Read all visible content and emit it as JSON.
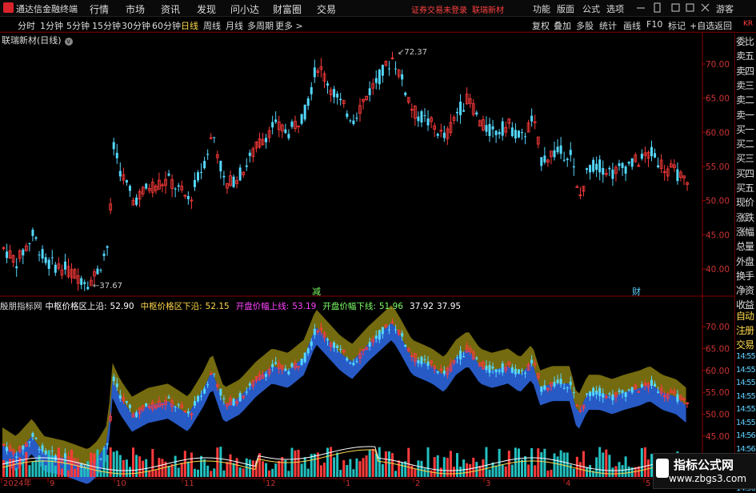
{
  "app": {
    "title": "通达信金融终端",
    "menus": [
      "行情",
      "市场",
      "资讯",
      "发现",
      "问小达",
      "财富圈",
      "交易"
    ],
    "warning": "证券交易未登录",
    "stock_name": "联瑞新材",
    "right_menus": [
      "功能",
      "版面",
      "公式",
      "选项"
    ],
    "guest": "游客"
  },
  "toolbar": {
    "periods": [
      "分时",
      "1分钟",
      "5分钟",
      "15分钟",
      "30分钟",
      "60分钟",
      "日线",
      "周线",
      "月线",
      "多周期",
      "更多 >"
    ],
    "active_period": "日线",
    "buttons": [
      "复权",
      "叠加",
      "多股",
      "统计",
      "画线",
      "F10",
      "标记",
      "+自选",
      "返回"
    ]
  },
  "main_chart": {
    "header": "联瑞新材(日线)",
    "price_labels": [
      "70.00",
      "65.00",
      "60.00",
      "55.00",
      "50.00",
      "45.00",
      "40.00"
    ],
    "high_label": "72.37",
    "low_label": "37.67",
    "marker_a": "减",
    "marker_b": "财",
    "colors": {
      "up": "#ff3b3b",
      "down": "#54d8ff",
      "bg": "#000000",
      "grid": "#5a0000"
    }
  },
  "indicator": {
    "name": "殷朋指标网",
    "items": [
      {
        "label": "中枢价格区上沿:",
        "value": "52.90",
        "color": "#ffffff"
      },
      {
        "label": "中枢价格区下沿:",
        "value": "52.15",
        "color": "#ffd94a"
      },
      {
        "label": "开盘价幅上线:",
        "value": "53.19",
        "color": "#ff44ff"
      },
      {
        "label": "开盘价幅下线:",
        "value": "51.96",
        "color": "#7cff66"
      },
      {
        "label": "",
        "value": "37.92",
        "color": "#ffffff"
      },
      {
        "label": "",
        "value": "37.95",
        "color": "#ffffff"
      }
    ],
    "price_labels": [
      "70.00",
      "65.00",
      "60.00",
      "55.00",
      "50.00",
      "45.00"
    ],
    "band_upper_color": "#7a7010",
    "band_lower_color": "#2a5fd0"
  },
  "xaxis": {
    "labels": [
      "2024年",
      "9",
      "10",
      "11",
      "12",
      "1",
      "2",
      "3",
      "4",
      "5"
    ]
  },
  "right_panel": {
    "code": "KR",
    "items": [
      "委比",
      "卖五",
      "卖四",
      "卖三",
      "卖二",
      "卖一",
      "买一",
      "买二",
      "买三",
      "买四",
      "买五",
      "现价",
      "涨跌",
      "涨幅",
      "总量",
      "外盘",
      "换手",
      "净资",
      "收益",
      "自动",
      "注册",
      "交易"
    ],
    "times": [
      "14:55",
      "14:55",
      "14:55",
      "14:55",
      "14:55",
      "14:55",
      "14:56",
      "14:56",
      "14:56",
      "14:56",
      "14:56"
    ]
  },
  "watermark": {
    "line1": "指标公式网",
    "line2": "www.zbgs3.com"
  }
}
